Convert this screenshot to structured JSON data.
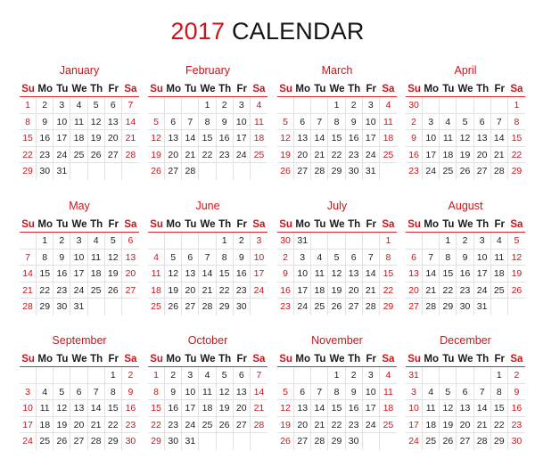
{
  "title": {
    "year": "2017",
    "text": "CALENDAR"
  },
  "colors": {
    "accent": "#c8161d",
    "text": "#1e1e1e",
    "grid": "#e2e2e2"
  },
  "weekdays": [
    "Su",
    "Mo",
    "Tu",
    "We",
    "Th",
    "Fr",
    "Sa"
  ],
  "months": [
    {
      "name": "January",
      "weeks": [
        [
          "1",
          "2",
          "3",
          "4",
          "5",
          "6",
          "7"
        ],
        [
          "8",
          "9",
          "10",
          "11",
          "12",
          "13",
          "14"
        ],
        [
          "15",
          "16",
          "17",
          "18",
          "19",
          "20",
          "21"
        ],
        [
          "22",
          "23",
          "24",
          "25",
          "26",
          "27",
          "28"
        ],
        [
          "29",
          "30",
          "31",
          "",
          "",
          "",
          ""
        ]
      ]
    },
    {
      "name": "February",
      "weeks": [
        [
          "",
          "",
          "",
          "1",
          "2",
          "3",
          "4"
        ],
        [
          "5",
          "6",
          "7",
          "8",
          "9",
          "10",
          "11"
        ],
        [
          "12",
          "13",
          "14",
          "15",
          "16",
          "17",
          "18"
        ],
        [
          "19",
          "20",
          "21",
          "22",
          "23",
          "24",
          "25"
        ],
        [
          "26",
          "27",
          "28",
          "",
          "",
          "",
          ""
        ]
      ]
    },
    {
      "name": "March",
      "weeks": [
        [
          "",
          "",
          "",
          "1",
          "2",
          "3",
          "4"
        ],
        [
          "5",
          "6",
          "7",
          "8",
          "9",
          "10",
          "11"
        ],
        [
          "12",
          "13",
          "14",
          "15",
          "16",
          "17",
          "18"
        ],
        [
          "19",
          "20",
          "21",
          "22",
          "23",
          "24",
          "25"
        ],
        [
          "26",
          "27",
          "28",
          "29",
          "30",
          "31",
          ""
        ]
      ]
    },
    {
      "name": "April",
      "weeks": [
        [
          "30",
          "",
          "",
          "",
          "",
          "",
          "1"
        ],
        [
          "2",
          "3",
          "4",
          "5",
          "6",
          "7",
          "8"
        ],
        [
          "9",
          "10",
          "11",
          "12",
          "13",
          "14",
          "15"
        ],
        [
          "16",
          "17",
          "18",
          "19",
          "20",
          "21",
          "22"
        ],
        [
          "23",
          "24",
          "25",
          "26",
          "27",
          "28",
          "29"
        ]
      ]
    },
    {
      "name": "May",
      "weeks": [
        [
          "",
          "1",
          "2",
          "3",
          "4",
          "5",
          "6"
        ],
        [
          "7",
          "8",
          "9",
          "10",
          "11",
          "12",
          "13"
        ],
        [
          "14",
          "15",
          "16",
          "17",
          "18",
          "19",
          "20"
        ],
        [
          "21",
          "22",
          "23",
          "24",
          "25",
          "26",
          "27"
        ],
        [
          "28",
          "29",
          "30",
          "31",
          "",
          "",
          ""
        ]
      ]
    },
    {
      "name": "June",
      "weeks": [
        [
          "",
          "",
          "",
          "",
          "1",
          "2",
          "3"
        ],
        [
          "4",
          "5",
          "6",
          "7",
          "8",
          "9",
          "10"
        ],
        [
          "11",
          "12",
          "13",
          "14",
          "15",
          "16",
          "17"
        ],
        [
          "18",
          "19",
          "20",
          "21",
          "22",
          "23",
          "24"
        ],
        [
          "25",
          "26",
          "27",
          "28",
          "29",
          "30",
          ""
        ]
      ]
    },
    {
      "name": "July",
      "weeks": [
        [
          "30",
          "31",
          "",
          "",
          "",
          "",
          "1"
        ],
        [
          "2",
          "3",
          "4",
          "5",
          "6",
          "7",
          "8"
        ],
        [
          "9",
          "10",
          "11",
          "12",
          "13",
          "14",
          "15"
        ],
        [
          "16",
          "17",
          "18",
          "19",
          "20",
          "21",
          "22"
        ],
        [
          "23",
          "24",
          "25",
          "26",
          "27",
          "28",
          "29"
        ]
      ]
    },
    {
      "name": "August",
      "weeks": [
        [
          "",
          "",
          "1",
          "2",
          "3",
          "4",
          "5"
        ],
        [
          "6",
          "7",
          "8",
          "9",
          "10",
          "11",
          "12"
        ],
        [
          "13",
          "14",
          "15",
          "16",
          "17",
          "18",
          "19"
        ],
        [
          "20",
          "21",
          "22",
          "23",
          "24",
          "25",
          "26"
        ],
        [
          "27",
          "28",
          "29",
          "30",
          "31",
          "",
          ""
        ]
      ]
    },
    {
      "name": "September",
      "weeks": [
        [
          "",
          "",
          "",
          "",
          "",
          "1",
          "2"
        ],
        [
          "3",
          "4",
          "5",
          "6",
          "7",
          "8",
          "9"
        ],
        [
          "10",
          "11",
          "12",
          "13",
          "14",
          "15",
          "16"
        ],
        [
          "17",
          "18",
          "19",
          "20",
          "21",
          "22",
          "23"
        ],
        [
          "24",
          "25",
          "26",
          "27",
          "28",
          "29",
          "30"
        ]
      ]
    },
    {
      "name": "October",
      "weeks": [
        [
          "1",
          "2",
          "3",
          "4",
          "5",
          "6",
          "7"
        ],
        [
          "8",
          "9",
          "10",
          "11",
          "12",
          "13",
          "14"
        ],
        [
          "15",
          "16",
          "17",
          "18",
          "19",
          "20",
          "21"
        ],
        [
          "22",
          "23",
          "24",
          "25",
          "26",
          "27",
          "28"
        ],
        [
          "29",
          "30",
          "31",
          "",
          "",
          "",
          ""
        ]
      ]
    },
    {
      "name": "November",
      "weeks": [
        [
          "",
          "",
          "",
          "1",
          "2",
          "3",
          "4"
        ],
        [
          "5",
          "6",
          "7",
          "8",
          "9",
          "10",
          "11"
        ],
        [
          "12",
          "13",
          "14",
          "15",
          "16",
          "17",
          "18"
        ],
        [
          "19",
          "20",
          "21",
          "22",
          "23",
          "24",
          "25"
        ],
        [
          "26",
          "27",
          "28",
          "29",
          "30",
          "",
          ""
        ]
      ]
    },
    {
      "name": "December",
      "weeks": [
        [
          "31",
          "",
          "",
          "",
          "",
          "1",
          "2"
        ],
        [
          "3",
          "4",
          "5",
          "6",
          "7",
          "8",
          "9"
        ],
        [
          "10",
          "11",
          "12",
          "13",
          "14",
          "15",
          "16"
        ],
        [
          "17",
          "18",
          "19",
          "20",
          "21",
          "22",
          "23"
        ],
        [
          "24",
          "25",
          "26",
          "27",
          "28",
          "29",
          "30"
        ]
      ]
    }
  ]
}
